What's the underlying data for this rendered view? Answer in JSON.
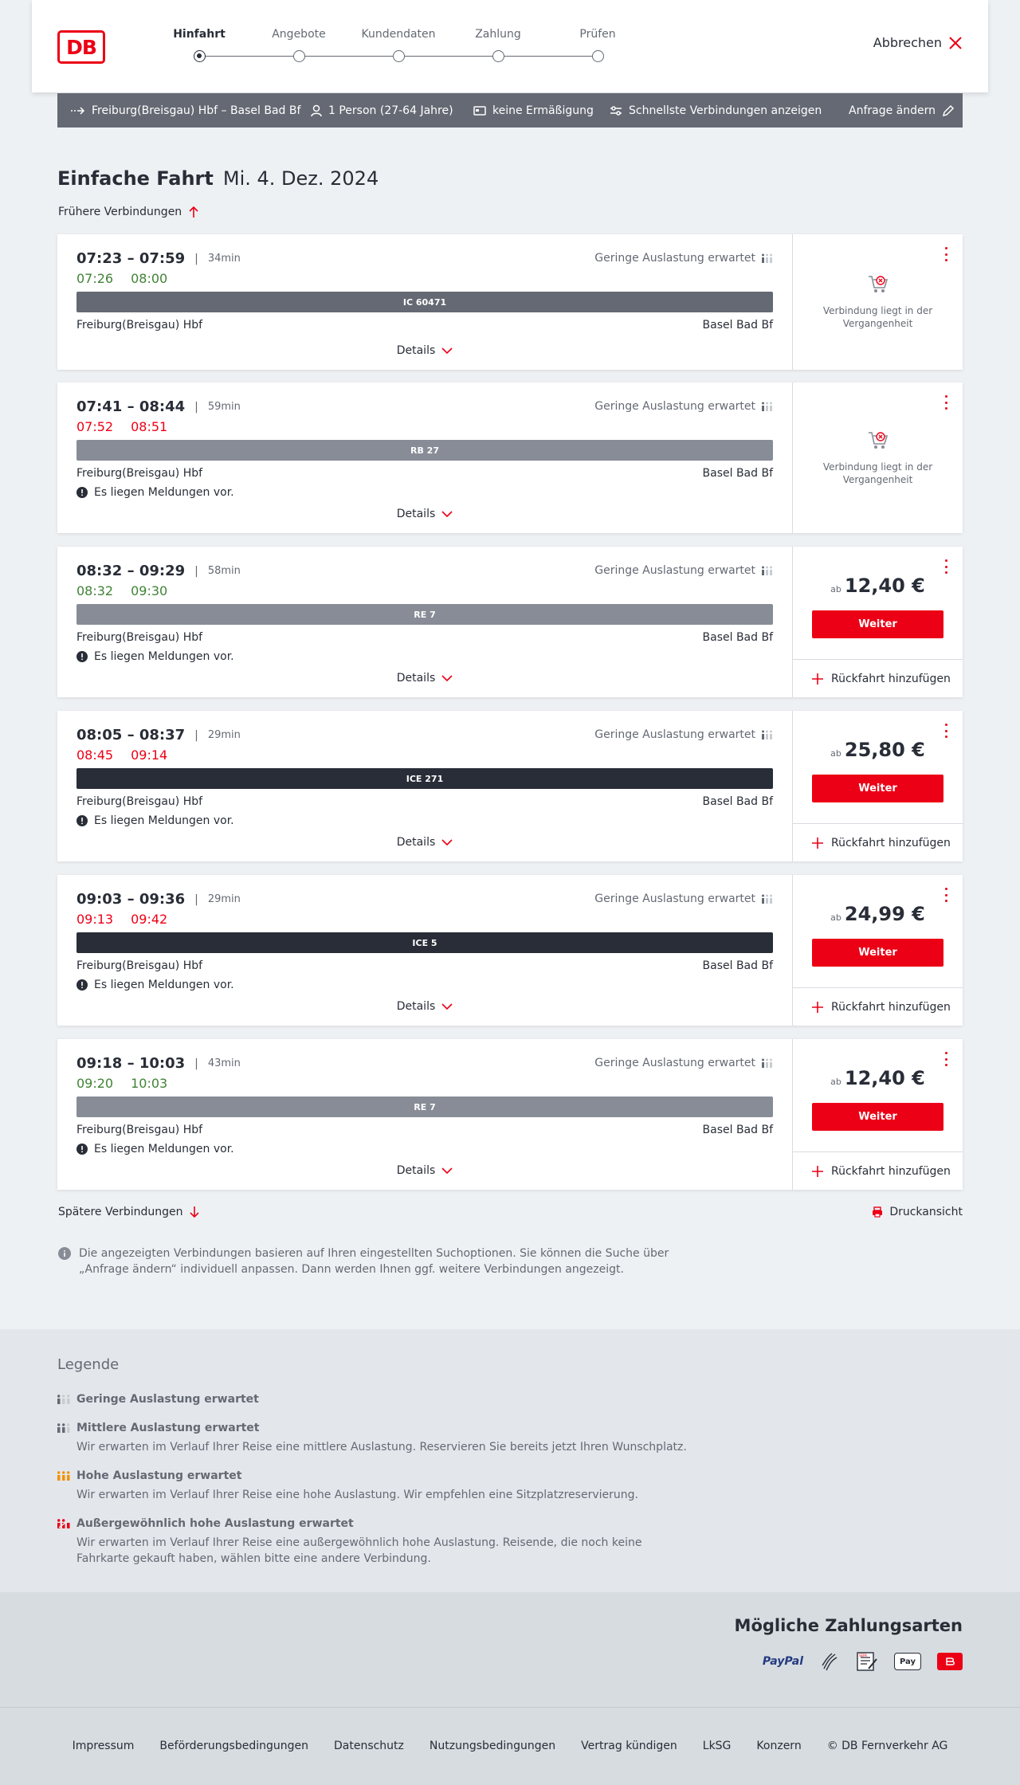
{
  "header": {
    "logo_text": "DB",
    "steps": [
      "Hinfahrt",
      "Angebote",
      "Kundendaten",
      "Zahlung",
      "Prüfen"
    ],
    "active_step": "Hinfahrt",
    "cancel_label": "Abbrechen"
  },
  "query": {
    "route": "Freiburg(Breisgau) Hbf – Basel Bad Bf",
    "passengers": "1 Person (27-64 Jahre)",
    "discount": "keine Ermäßigung",
    "fastest": "Schnellste Verbindungen anzeigen",
    "change_label": "Anfrage ändern"
  },
  "title": {
    "main": "Einfache Fahrt",
    "date": "Mi. 4. Dez. 2024"
  },
  "earlier_label": "Frühere Verbindungen",
  "later_label": "Spätere Verbindungen",
  "print_label": "Druckansicht",
  "info_text": "Die angezeigten Verbindungen basieren auf Ihren eingestellten Suchoptionen. Sie können die Suche über „Anfrage ändern“ individuell anpassen. Dann werden Ihnen ggf. weitere Verbindungen angezeigt.",
  "connections": [
    {
      "times": "07:23 – 07:59",
      "duration": "34min",
      "rt_dep": "07:26",
      "rt_arr": "08:00",
      "rt_color": "green",
      "load": "Geringe Auslastung erwartet",
      "train": "IC 60471",
      "from": "Freiburg(Breisgau) Hbf",
      "to": "Basel Bad Bf",
      "message": "",
      "details": "Details",
      "past_text": "Verbindung liegt in der Vergangenheit"
    },
    {
      "times": "07:41 – 08:44",
      "duration": "59min",
      "rt_dep": "07:52",
      "rt_arr": "08:51",
      "rt_color": "red",
      "load": "Geringe Auslastung erwartet",
      "train": "RB 27",
      "from": "Freiburg(Breisgau) Hbf",
      "to": "Basel Bad Bf",
      "message": "Es liegen Meldungen vor.",
      "details": "Details",
      "past_text": "Verbindung liegt in der Vergangenheit"
    },
    {
      "times": "08:32 – 09:29",
      "duration": "58min",
      "rt_dep": "08:32",
      "rt_arr": "09:30",
      "rt_color": "green",
      "load": "Geringe Auslastung erwartet",
      "train": "RE 7",
      "from": "Freiburg(Breisgau) Hbf",
      "to": "Basel Bad Bf",
      "message": "Es liegen Meldungen vor.",
      "details": "Details",
      "price_prefix": "ab",
      "price": "12,40 €",
      "button": "Weiter",
      "return": "Rückfahrt hinzufügen"
    },
    {
      "times": "08:05 – 08:37",
      "duration": "29min",
      "rt_dep": "08:45",
      "rt_arr": "09:14",
      "rt_color": "red",
      "load": "Geringe Auslastung erwartet",
      "train": "ICE 271",
      "from": "Freiburg(Breisgau) Hbf",
      "to": "Basel Bad Bf",
      "message": "Es liegen Meldungen vor.",
      "details": "Details",
      "price_prefix": "ab",
      "price": "25,80 €",
      "button": "Weiter",
      "return": "Rückfahrt hinzufügen"
    },
    {
      "times": "09:03 – 09:36",
      "duration": "29min",
      "rt_dep": "09:13",
      "rt_arr": "09:42",
      "rt_color": "red",
      "load": "Geringe Auslastung erwartet",
      "train": "ICE 5",
      "from": "Freiburg(Breisgau) Hbf",
      "to": "Basel Bad Bf",
      "message": "Es liegen Meldungen vor.",
      "details": "Details",
      "price_prefix": "ab",
      "price": "24,99 €",
      "button": "Weiter",
      "return": "Rückfahrt hinzufügen"
    },
    {
      "times": "09:18 – 10:03",
      "duration": "43min",
      "rt_dep": "09:20",
      "rt_arr": "10:03",
      "rt_color": "green",
      "load": "Geringe Auslastung erwartet",
      "train": "RE 7",
      "from": "Freiburg(Breisgau) Hbf",
      "to": "Basel Bad Bf",
      "message": "Es liegen Meldungen vor.",
      "details": "Details",
      "price_prefix": "ab",
      "price": "12,40 €",
      "button": "Weiter",
      "return": "Rückfahrt hinzufügen"
    }
  ],
  "legend": {
    "title": "Legende",
    "items": [
      {
        "title": "Geringe Auslastung erwartet",
        "desc": ""
      },
      {
        "title": "Mittlere Auslastung erwartet",
        "desc": "Wir erwarten im Verlauf Ihrer Reise eine mittlere Auslastung. Reservieren Sie bereits jetzt Ihren Wunschplatz."
      },
      {
        "title": "Hohe Auslastung erwartet",
        "desc": "Wir erwarten im Verlauf Ihrer Reise eine hohe Auslastung. Wir empfehlen eine Sitzplatzreservierung."
      },
      {
        "title": "Außergewöhnlich hohe Auslastung erwartet",
        "desc": "Wir erwarten im Verlauf Ihrer Reise eine außergewöhnlich hohe Auslastung. Reisende, die noch keine Fahrkarte gekauft haben, wählen bitte eine andere Verbindung."
      }
    ]
  },
  "payment": {
    "title": "Mögliche Zahlungsarten",
    "paypal": "PayPal",
    "sepa": "SEPA",
    "applepay": "Pay"
  },
  "footer": [
    "Impressum",
    "Beförderungsbedingungen",
    "Datenschutz",
    "Nutzungsbedingungen",
    "Vertrag kündigen",
    "LkSG",
    "Konzern",
    "© DB Fernverkehr AG"
  ],
  "colors": {
    "brand_red": "#ec0016",
    "delay_green": "#408335",
    "text": "#282d37",
    "muted": "#646973"
  }
}
